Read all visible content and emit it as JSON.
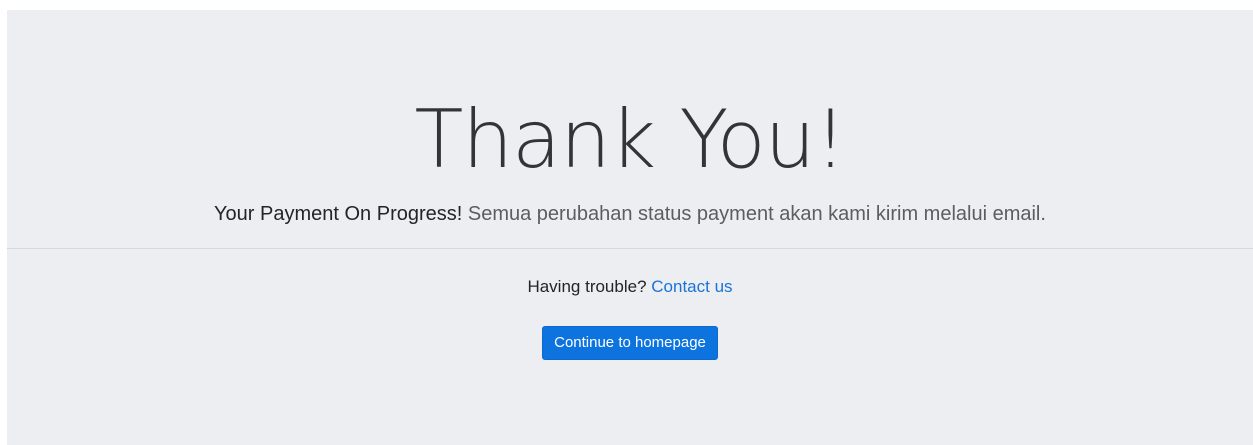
{
  "page": {
    "title": "Thank You!",
    "lead_strong": "Your Payment On Progress!",
    "lead_text": " Semua perubahan status payment akan kami kirim melalui email.",
    "trouble_text": "Having trouble? ",
    "contact_link": "Contact us",
    "continue_button": "Continue to homepage"
  },
  "colors": {
    "background": "#eceef1",
    "primary": "#0d74df",
    "link": "#1a73d9"
  }
}
